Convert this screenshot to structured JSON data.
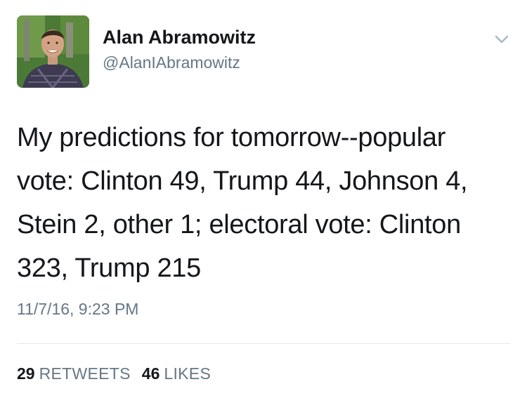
{
  "tweet": {
    "author_name": "Alan Abramowitz",
    "author_handle": "@AlanIAbramowitz",
    "text": "My predictions for tomorrow--popular\nvote: Clinton 49, Trump 44, Johnson 4,\nStein 2, other 1; electoral vote: Clinton\n323, Trump 215",
    "timestamp": "11/7/16, 9:23 PM"
  },
  "stats": {
    "retweets_count": "29",
    "retweets_label": "RETWEETS",
    "likes_count": "46",
    "likes_label": "LIKES"
  },
  "icons": {
    "menu": "chevron-down-icon"
  },
  "colors": {
    "text_primary": "#14171a",
    "text_secondary": "#657786",
    "divider": "#e1e8ed"
  }
}
